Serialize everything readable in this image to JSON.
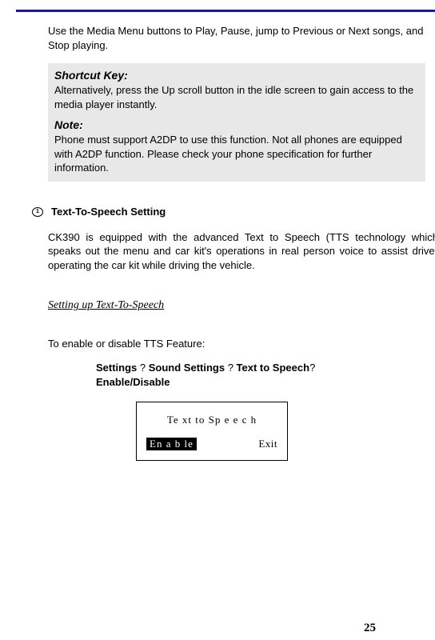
{
  "intro": "Use the Media Menu buttons to Play, Pause, jump to Previous or Next songs, and Stop playing.",
  "graybox": {
    "shortcut_hdr": "Shortcut Key:",
    "shortcut_body": "Alternatively, press the Up scroll button in the idle screen to gain access to the media player instantly.",
    "note_hdr": "Note:",
    "note_body": "Phone must support A2DP to use this function. Not all phones are equipped with A2DP function. Please check your phone specification for further information."
  },
  "tts": {
    "title": "Text-To-Speech Setting",
    "para": "CK390 is equipped with the advanced Text to Speech (TTS technology which speaks out the menu and car kit's operations in real person voice to assist driver operating the car kit while driving the vehicle.",
    "subheading": "Setting up Text-To-Speech",
    "enable_intro": "To enable or disable TTS Feature:",
    "navpath_line1a": "Settings ",
    "q": "?",
    "navpath_line1b": " Sound Settings ",
    "navpath_line1c": " Text to Speech",
    "navpath_line1d": " Enable/Disable"
  },
  "device": {
    "title": "Te xt to Sp e e c h",
    "enable": "En a b le",
    "exit": "Exit"
  },
  "page_number": "25",
  "bullet_glyph": "1"
}
